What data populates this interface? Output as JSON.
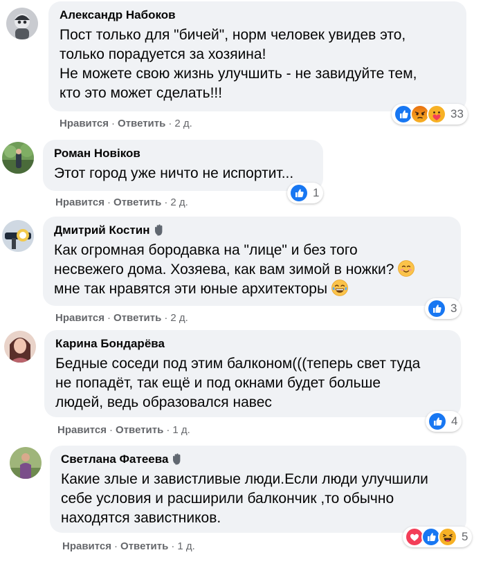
{
  "comments": [
    {
      "author": "Александр Набоков",
      "lines": "Пост только для \"бичей\", норм человек увидев это,\nтолько порадуется за хозяина!\nНе можете свою жизнь улучшить - не завидуйте тем,\nкто это может сделать!!!",
      "like_label": "Нравится",
      "reply_label": "Ответить",
      "time": "2 д.",
      "reaction_count": "33",
      "reactions": [
        "like-icon",
        "angry-icon",
        "care-icon"
      ]
    },
    {
      "author": "Роман Новіков",
      "lines": "Этот город уже ничто не испортит...",
      "like_label": "Нравится",
      "reply_label": "Ответить",
      "time": "2 д.",
      "reaction_count": "1",
      "reactions": [
        "like-icon"
      ]
    },
    {
      "author": "Дмитрий Костин",
      "lines_a": "Как огромная бородавка на \"лице\" и без того\nнесвежего дома. Хозяева, как вам зимой в ножки? ",
      "lines_b": "\nмне так нравятся эти юные архитекторы ",
      "like_label": "Нравится",
      "reply_label": "Ответить",
      "time": "2 д.",
      "reaction_count": "3",
      "reactions": [
        "like-icon"
      ]
    },
    {
      "author": "Карина Бондарёва",
      "lines": "Бедные соседи под этим балконом(((теперь свет туда\nне попадёт, так ещё и под окнами будет больше\nлюдей, ведь образовался навес",
      "like_label": "Нравится",
      "reply_label": "Ответить",
      "time": "1 д.",
      "reaction_count": "4",
      "reactions": [
        "like-icon"
      ]
    },
    {
      "author": "Светлана Фатеева",
      "lines": "Какие злые и завистливые люди.Если люди улучшили\nсебе условия и расширили балкончик ,то обычно\nнаходятся завистников.",
      "like_label": "Нравится",
      "reply_label": "Ответить",
      "time": "1 д.",
      "reaction_count": "5",
      "reactions": [
        "love-icon",
        "like-icon",
        "haha-icon"
      ]
    }
  ],
  "separator": "·",
  "colors": {
    "bubble": "#f0f2f5",
    "like": "#1877f2",
    "meta": "#65676b",
    "love": "#f33e58",
    "haha": "#f7b125"
  }
}
